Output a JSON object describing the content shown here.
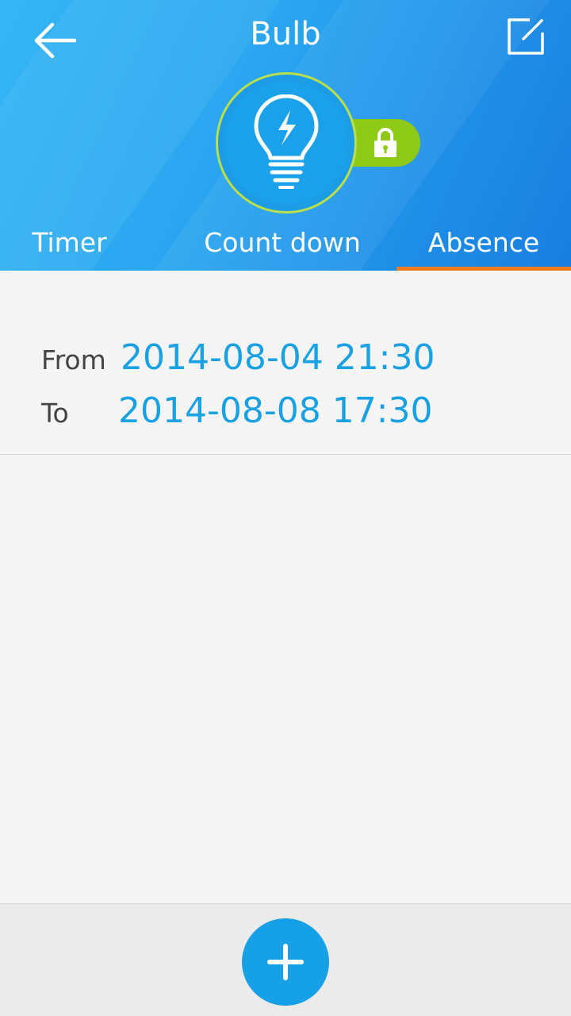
{
  "header": {
    "title": "Bulb",
    "icons": {
      "back": "arrow-left-icon",
      "edit": "edit-square-icon",
      "device": "lightbulb-icon",
      "lock": "lock-icon"
    },
    "colors": {
      "accent_lock": "#8dc916",
      "tab_indicator": "#f47b20"
    }
  },
  "tabs": [
    {
      "label": "Timer",
      "active": false
    },
    {
      "label": "Count down",
      "active": false
    },
    {
      "label": "Absence",
      "active": true
    }
  ],
  "absence": {
    "from_label": "From",
    "from_value": "2014-08-04 21:30",
    "to_label": "To",
    "to_value": "2014-08-08 17:30"
  },
  "footer": {
    "add_icon": "plus-icon",
    "accent": "#16a1e6"
  }
}
